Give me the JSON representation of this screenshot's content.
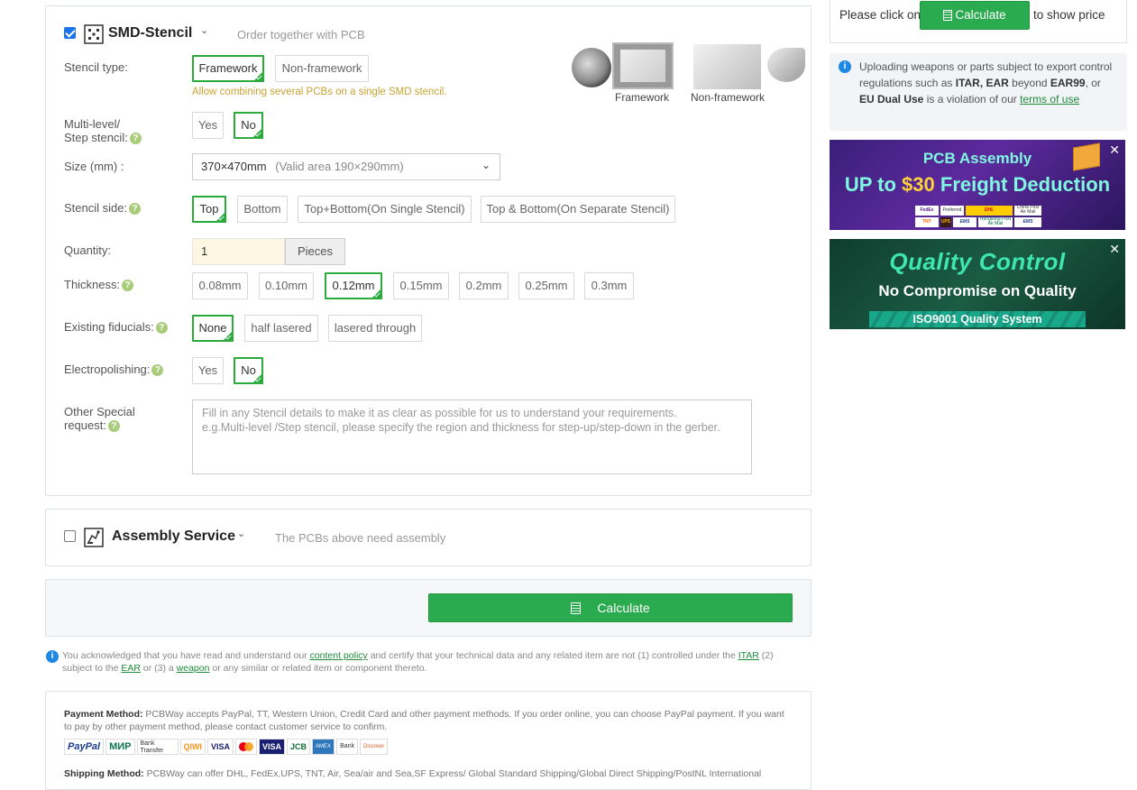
{
  "stencil": {
    "title": "SMD-Stencil",
    "subtitle": "Order together with PCB",
    "checked": true,
    "type_label": "Stencil type:",
    "type_options": [
      "Framework",
      "Non-framework"
    ],
    "type_selected": "Framework",
    "type_note": "Allow combining several PCBs on a single SMD stencil.",
    "image_captions": [
      "Framework",
      "Non-framework"
    ],
    "multilevel_label_1": "Multi-level/",
    "multilevel_label_2": "Step stencil:",
    "multilevel_options": [
      "Yes",
      "No"
    ],
    "size_label": "Size (mm) :",
    "size_value": "370×470mm",
    "size_note": "(Valid area 190×290mm)",
    "side_label": "Stencil side:",
    "side_options": [
      "Top",
      "Bottom",
      "Top+Bottom(On Single Stencil)",
      "Top & Bottom(On Separate Stencil)"
    ],
    "quantity_label": "Quantity:",
    "quantity_value": "1",
    "quantity_unit": "Pieces",
    "thickness_label": "Thickness:",
    "thickness_options": [
      "0.08mm",
      "0.10mm",
      "0.12mm",
      "0.15mm",
      "0.2mm",
      "0.25mm",
      "0.3mm"
    ],
    "fiducials_label": "Existing fiducials:",
    "fiducials_options": [
      "None",
      "half lasered",
      "lasered through"
    ],
    "electro_label": "Electropolishing:",
    "electro_options": [
      "Yes",
      "No"
    ],
    "special_label_1": "Other Special",
    "special_label_2": "request:",
    "special_placeholder_1": "Fill in any Stencil details to make it as clear as possible for us to understand your requirements.",
    "special_placeholder_2": "e.g.Multi-level /Step stencil, please specify the region and thickness for step-up/step-down in the gerber."
  },
  "assembly": {
    "title": "Assembly Service",
    "subtitle": "The PCBs above need assembly",
    "checked": false
  },
  "calculate_label": "Calculate",
  "ack": {
    "t1": "You acknowledged that you have read and understand our ",
    "link1": "content policy",
    "t2": " and certify that your technical data and any related item are not (1) controlled under the ",
    "link2": "ITAR",
    "t3": " (2)",
    "t4": "subject to the ",
    "link3": "EAR",
    "t5": " or (3) a ",
    "link4": "weapon",
    "t6": " or any similar or related item or component thereto."
  },
  "payment": {
    "heading": "Payment Method:",
    "text": " PCBWay accepts PayPal, TT, Western Union, Credit Card and other payment methods. If you order online, you can choose PayPal payment. If you want to pay by other payment method, please contact customer service to confirm.",
    "logos": [
      "PayPal",
      "МИР",
      "Bank Transfer",
      "QIWI",
      "VISA",
      "MC",
      "VISA",
      "JCB",
      "AMEX",
      "Bank",
      "Discover"
    ],
    "shipping_heading": "Shipping Method:",
    "shipping_text": " PCBWay can offer DHL, FedEx,UPS, TNT, Air, Sea/air and Sea,SF Express/ Global Standard Shipping/Global Direct Shipping/PostNL International"
  },
  "sidebar": {
    "price_prefix": "Please click on",
    "price_button": "Calculate",
    "price_suffix": "to show price",
    "notice_t1": "Uploading weapons or parts subject to export control regulations such as ",
    "notice_b1": "ITAR, EAR",
    "notice_t2": " beyond ",
    "notice_b2": "EAR99",
    "notice_t3": ", or ",
    "notice_b3": "EU Dual Use",
    "notice_t4": " is a violation of our ",
    "notice_link": "terms of use",
    "banner1": {
      "title": "PCB Assembly",
      "line_a": "UP to ",
      "line_amount": "$30",
      "line_b": " Freight Deduction",
      "carriers": [
        "FedEx",
        "Preferred Carrier",
        "DHL",
        "China Post Air Mail",
        "TNT",
        "UPS",
        "EMS",
        "Hongkong Post Air Mail",
        "EMS"
      ]
    },
    "banner2": {
      "title": "Quality Control",
      "subtitle": "No Compromise on Quality",
      "badge": "ISO9001 Quality System"
    }
  },
  "colors": {
    "accent": "#2bab4f",
    "selected_border": "#2bab3c",
    "link": "#1f8a3a",
    "note_yellow": "#c8a232"
  }
}
